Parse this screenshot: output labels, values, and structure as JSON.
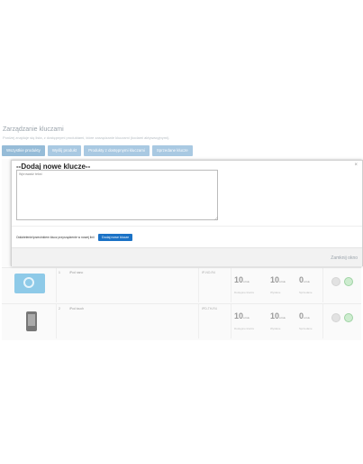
{
  "page": {
    "title": "Zarządzanie kluczami",
    "subtitle": "Poniżej znajduje się lista, z dostępnymi produktami, które zarządzanie kluczami (kodami aktywacyjnymi)."
  },
  "tabs": [
    {
      "label": "Wszystkie produkty"
    },
    {
      "label": "Wyślij produkt"
    },
    {
      "label": "Produkty z dostępnymi kluczami"
    },
    {
      "label": "Sprzedane klucze"
    }
  ],
  "products": [
    {
      "image_icon": "ipod-image",
      "number": "1",
      "name": "iPod nano",
      "code": "IP-NO-R4",
      "stats": [
        {
          "value": "10",
          "unit": "sztuk",
          "label": "Dostępne klucze"
        },
        {
          "value": "10",
          "unit": "sztuk",
          "label": "Wysłane"
        },
        {
          "value": "0",
          "unit": "sztuk",
          "label": "Sprzedane"
        }
      ]
    },
    {
      "image_icon": "phone-image",
      "number": "2",
      "name": "iPod touch",
      "code": "IPD-TH-R4",
      "stats": [
        {
          "value": "10",
          "unit": "sztuk",
          "label": "Dostępne klucze"
        },
        {
          "value": "10",
          "unit": "sztuk",
          "label": "Wysłane"
        },
        {
          "value": "0",
          "unit": "sztuk",
          "label": "Sprzedane"
        }
      ]
    }
  ],
  "modal": {
    "title": "--Dodaj nowe klucze--",
    "close_label": "×",
    "textarea_placeholder": "Wprowadź tekst",
    "hint": "Oddzielenie/przecinkiem klucz przyrządzenie w nowej linii",
    "add_button": "Dodaj nowe klucze",
    "close_window": "Zamknij okno"
  }
}
